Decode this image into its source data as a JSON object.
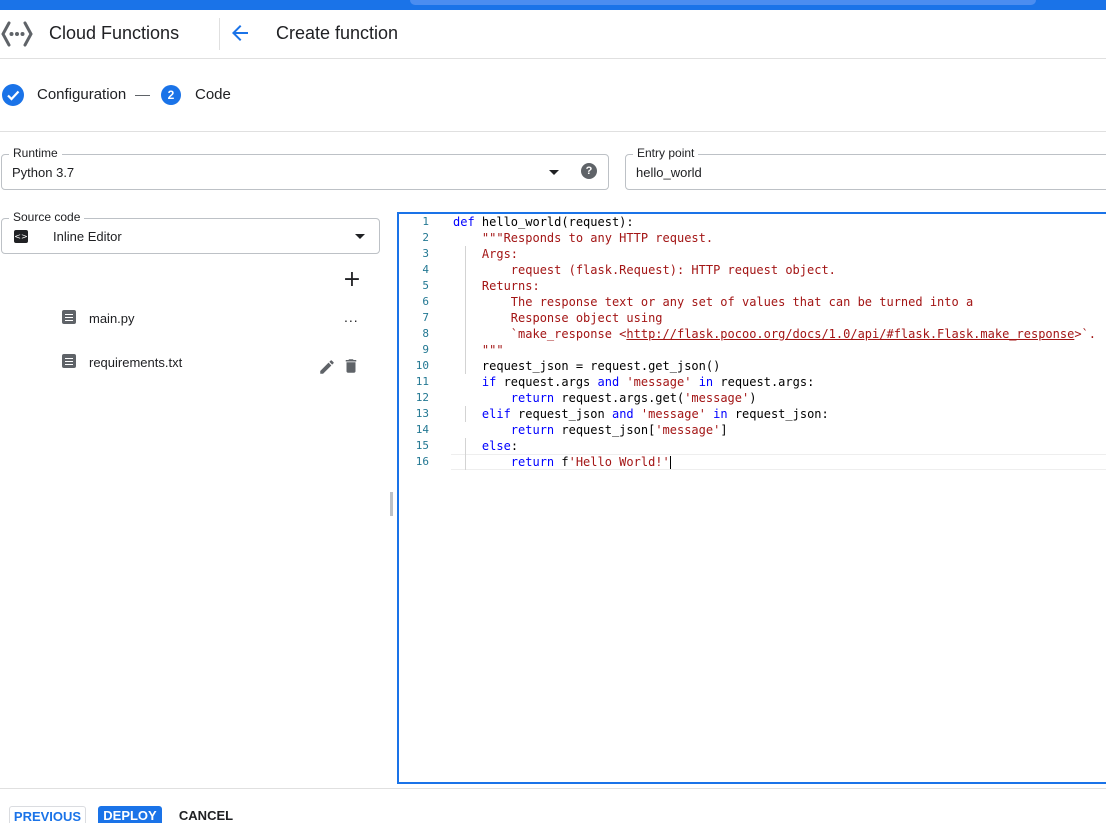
{
  "header": {
    "app_title": "Cloud Functions",
    "page_title": "Create function"
  },
  "stepper": {
    "step1_label": "Configuration",
    "step2_number": "2",
    "step2_label": "Code"
  },
  "runtime": {
    "label": "Runtime",
    "value": "Python 3.7",
    "help": "?"
  },
  "entry_point": {
    "label": "Entry point",
    "value": "hello_world"
  },
  "source_code": {
    "label": "Source code",
    "value": "Inline Editor",
    "icon_glyph": "<>"
  },
  "files": [
    {
      "name": "main.py",
      "more": "..."
    },
    {
      "name": "requirements.txt"
    }
  ],
  "add_glyph": "+",
  "editor": {
    "line_numbers": [
      "1",
      "2",
      "3",
      "4",
      "5",
      "6",
      "7",
      "8",
      "9",
      "10",
      "11",
      "12",
      "13",
      "14",
      "15",
      "16"
    ],
    "lines": [
      [
        "def",
        " hello_world(request):"
      ],
      [
        "    ",
        "\"\"\"Responds to any HTTP request."
      ],
      [
        "    ",
        "Args:"
      ],
      [
        "        ",
        "request (flask.Request): HTTP request object."
      ],
      [
        "    ",
        "Returns:"
      ],
      [
        "        ",
        "The response text or any set of values that can be turned into a"
      ],
      [
        "        ",
        "Response object using"
      ],
      [
        "        ",
        "`make_response <",
        "http://flask.pocoo.org/docs/1.0/api/#flask.Flask.make_response",
        ">`."
      ],
      [
        "    ",
        "\"\"\""
      ],
      [
        "    ",
        "request_json = request.get_json()"
      ],
      [
        "    ",
        "if",
        " request.args ",
        "and",
        " ",
        "'message'",
        " ",
        "in",
        " request.args:"
      ],
      [
        "        ",
        "return",
        " request.args.get(",
        "'message'",
        ")"
      ],
      [
        "    ",
        "elif",
        " request_json ",
        "and",
        " ",
        "'message'",
        " ",
        "in",
        " request_json:"
      ],
      [
        "        ",
        "return",
        " request_json[",
        "'message'",
        "]"
      ],
      [
        "    ",
        "else",
        ":"
      ],
      [
        "        ",
        "return",
        " f",
        "'Hello World!'"
      ]
    ]
  },
  "buttons": {
    "previous": "PREVIOUS",
    "deploy": "DEPLOY",
    "cancel": "CANCEL"
  },
  "colors": {
    "accent": "#1a73e8",
    "keyword": "#0000ff",
    "string": "#a31515",
    "line_number": "#237893"
  },
  "icons": {
    "logo": "cloud-functions-logo",
    "back": "arrow-left-icon",
    "step1": "check-circle-icon",
    "help": "help-icon",
    "source": "code-icon",
    "dropdown": "dropdown-arrow-icon",
    "add": "add-icon",
    "file": "file-icon",
    "more": "more-horiz-icon",
    "edit": "pencil-icon",
    "delete": "trash-icon"
  }
}
